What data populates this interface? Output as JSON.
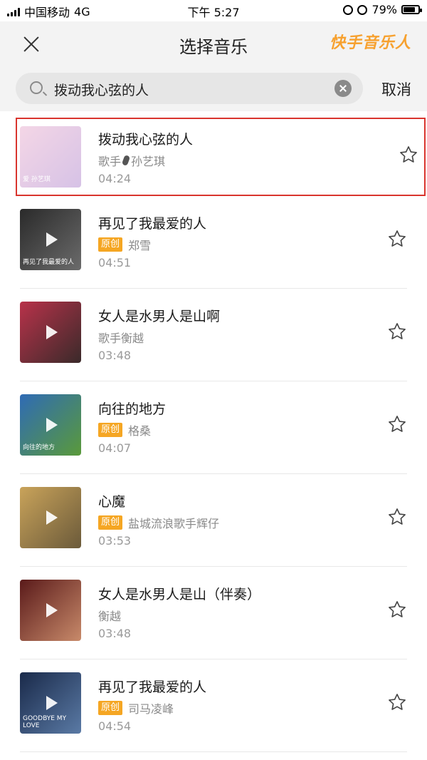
{
  "status_bar": {
    "carrier": "中国移动",
    "network": "4G",
    "time": "下午 5:27",
    "battery": "79%",
    "battery_level": 0.79
  },
  "header": {
    "title": "选择音乐",
    "logo_text": "快手音乐人",
    "brand_color": "#f7a12f"
  },
  "search": {
    "query": "拨动我心弦的人",
    "cancel_label": "取消"
  },
  "songs": [
    {
      "title": "拨动我心弦的人",
      "artist_prefix": "歌手",
      "artist": "孙艺琪",
      "badge": "",
      "duration": "04:24",
      "selected": true,
      "thumb_label": "爱 孙艺琪",
      "thumb_colors": [
        "#f4d6e6",
        "#d6c2e6"
      ]
    },
    {
      "title": "再见了我最爱的人",
      "artist_prefix": "",
      "artist": "郑雪",
      "badge": "原创",
      "duration": "04:51",
      "selected": false,
      "thumb_label": "再见了我最爱的人",
      "thumb_colors": [
        "#2a2a2a",
        "#6b6b6b"
      ]
    },
    {
      "title": "女人是水男人是山啊",
      "artist_prefix": "",
      "artist": "歌手衡越",
      "badge": "",
      "duration": "03:48",
      "selected": false,
      "thumb_label": "",
      "thumb_colors": [
        "#b8324a",
        "#3a2a2a"
      ]
    },
    {
      "title": "向往的地方",
      "artist_prefix": "",
      "artist": "格桑",
      "badge": "原创",
      "duration": "04:07",
      "selected": false,
      "thumb_label": "向往的地方",
      "thumb_colors": [
        "#2f6bb5",
        "#5a9a3a"
      ]
    },
    {
      "title": "心魔",
      "artist_prefix": "",
      "artist": "盐城流浪歌手辉仔",
      "badge": "原创",
      "duration": "03:53",
      "selected": false,
      "thumb_label": "",
      "thumb_colors": [
        "#c9a35a",
        "#6b5a3a"
      ]
    },
    {
      "title": "女人是水男人是山（伴奏）",
      "artist_prefix": "",
      "artist": "衡越",
      "badge": "",
      "duration": "03:48",
      "selected": false,
      "thumb_label": "",
      "thumb_colors": [
        "#5a1a1a",
        "#c88a6a"
      ]
    },
    {
      "title": "再见了我最爱的人",
      "artist_prefix": "",
      "artist": "司马凌峰",
      "badge": "原创",
      "duration": "04:54",
      "selected": false,
      "thumb_label": "GOODBYE MY LOVE",
      "thumb_colors": [
        "#1a2a4a",
        "#5a7aa5"
      ]
    }
  ],
  "colors": {
    "badge": "#f5a623",
    "selected_border": "#d9352e"
  }
}
